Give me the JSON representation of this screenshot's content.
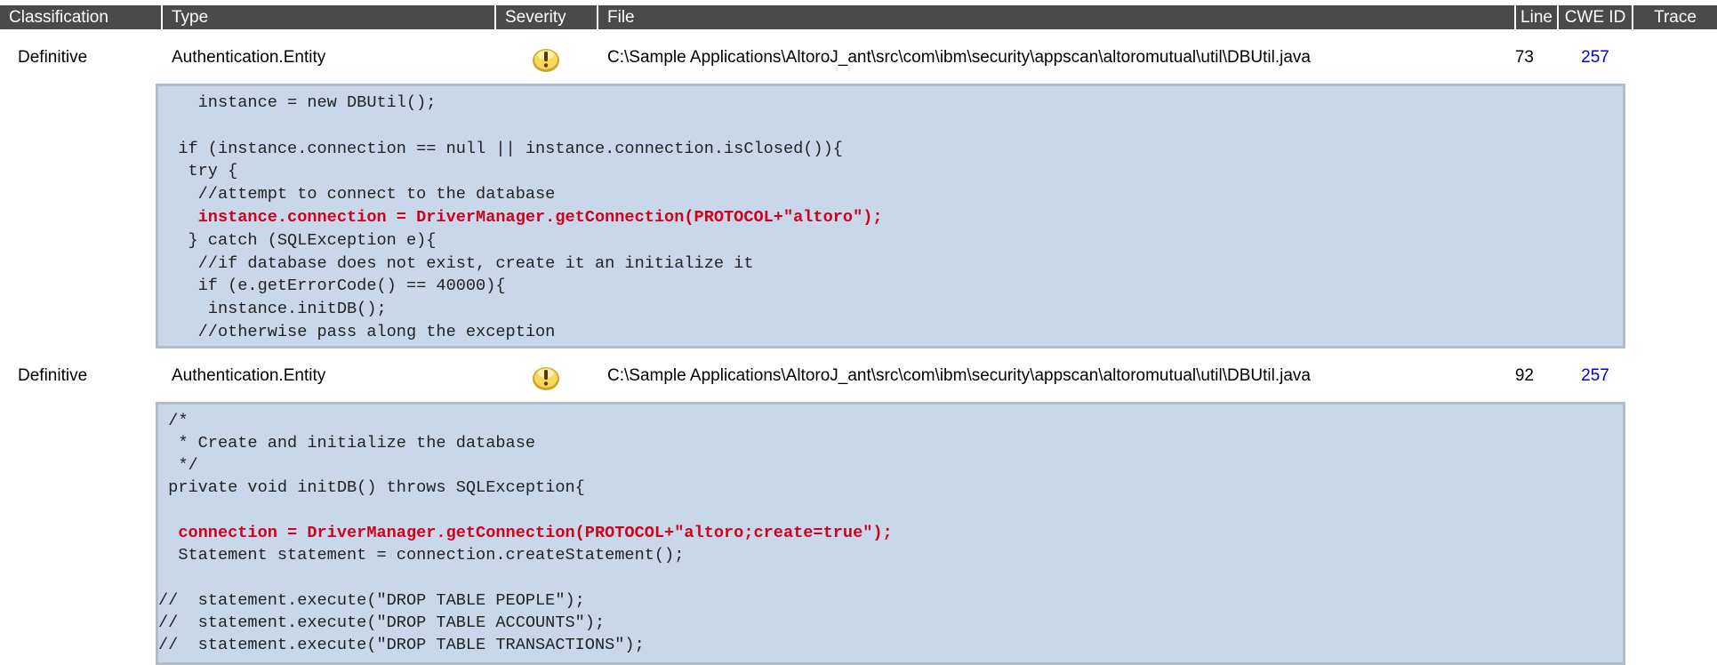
{
  "header": {
    "classification": "Classification",
    "type": "Type",
    "severity": "Severity",
    "file": "File",
    "line": "Line",
    "cwe": "CWE ID",
    "trace": "Trace"
  },
  "findings": [
    {
      "classification": "Definitive",
      "type": "Authentication.Entity",
      "severity_icon": "warning-icon",
      "file": "C:\\Sample Applications\\AltoroJ_ant\\src\\com\\ibm\\security\\appscan\\altoromutual\\util\\DBUtil.java",
      "line": "73",
      "cwe": "257",
      "code": [
        {
          "text": "    instance = new DBUtil();",
          "highlight": false
        },
        {
          "text": "",
          "highlight": false
        },
        {
          "text": "  if (instance.connection == null || instance.connection.isClosed()){",
          "highlight": false
        },
        {
          "text": "   try {",
          "highlight": false
        },
        {
          "text": "    //attempt to connect to the database",
          "highlight": false
        },
        {
          "text": "    instance.connection = DriverManager.getConnection(PROTOCOL+\"altoro\");",
          "highlight": true
        },
        {
          "text": "   } catch (SQLException e){",
          "highlight": false
        },
        {
          "text": "    //if database does not exist, create it an initialize it",
          "highlight": false
        },
        {
          "text": "    if (e.getErrorCode() == 40000){",
          "highlight": false
        },
        {
          "text": "     instance.initDB();",
          "highlight": false
        },
        {
          "text": "    //otherwise pass along the exception",
          "highlight": false
        }
      ]
    },
    {
      "classification": "Definitive",
      "type": "Authentication.Entity",
      "severity_icon": "warning-icon",
      "file": "C:\\Sample Applications\\AltoroJ_ant\\src\\com\\ibm\\security\\appscan\\altoromutual\\util\\DBUtil.java",
      "line": "92",
      "cwe": "257",
      "code": [
        {
          "text": " /*",
          "highlight": false
        },
        {
          "text": "  * Create and initialize the database",
          "highlight": false
        },
        {
          "text": "  */",
          "highlight": false
        },
        {
          "text": " private void initDB() throws SQLException{",
          "highlight": false
        },
        {
          "text": "",
          "highlight": false
        },
        {
          "text": "  connection = DriverManager.getConnection(PROTOCOL+\"altoro;create=true\");",
          "highlight": true
        },
        {
          "text": "  Statement statement = connection.createStatement();",
          "highlight": false
        },
        {
          "text": "",
          "highlight": false
        },
        {
          "text": "//  statement.execute(\"DROP TABLE PEOPLE\");",
          "highlight": false
        },
        {
          "text": "//  statement.execute(\"DROP TABLE ACCOUNTS\");",
          "highlight": false
        },
        {
          "text": "//  statement.execute(\"DROP TABLE TRANSACTIONS\");",
          "highlight": false
        }
      ]
    }
  ],
  "colors": {
    "header_bg": "#4a4a4a",
    "code_bg": "#c9d7ea",
    "highlight": "#d0021b",
    "link": "#0000cc"
  }
}
